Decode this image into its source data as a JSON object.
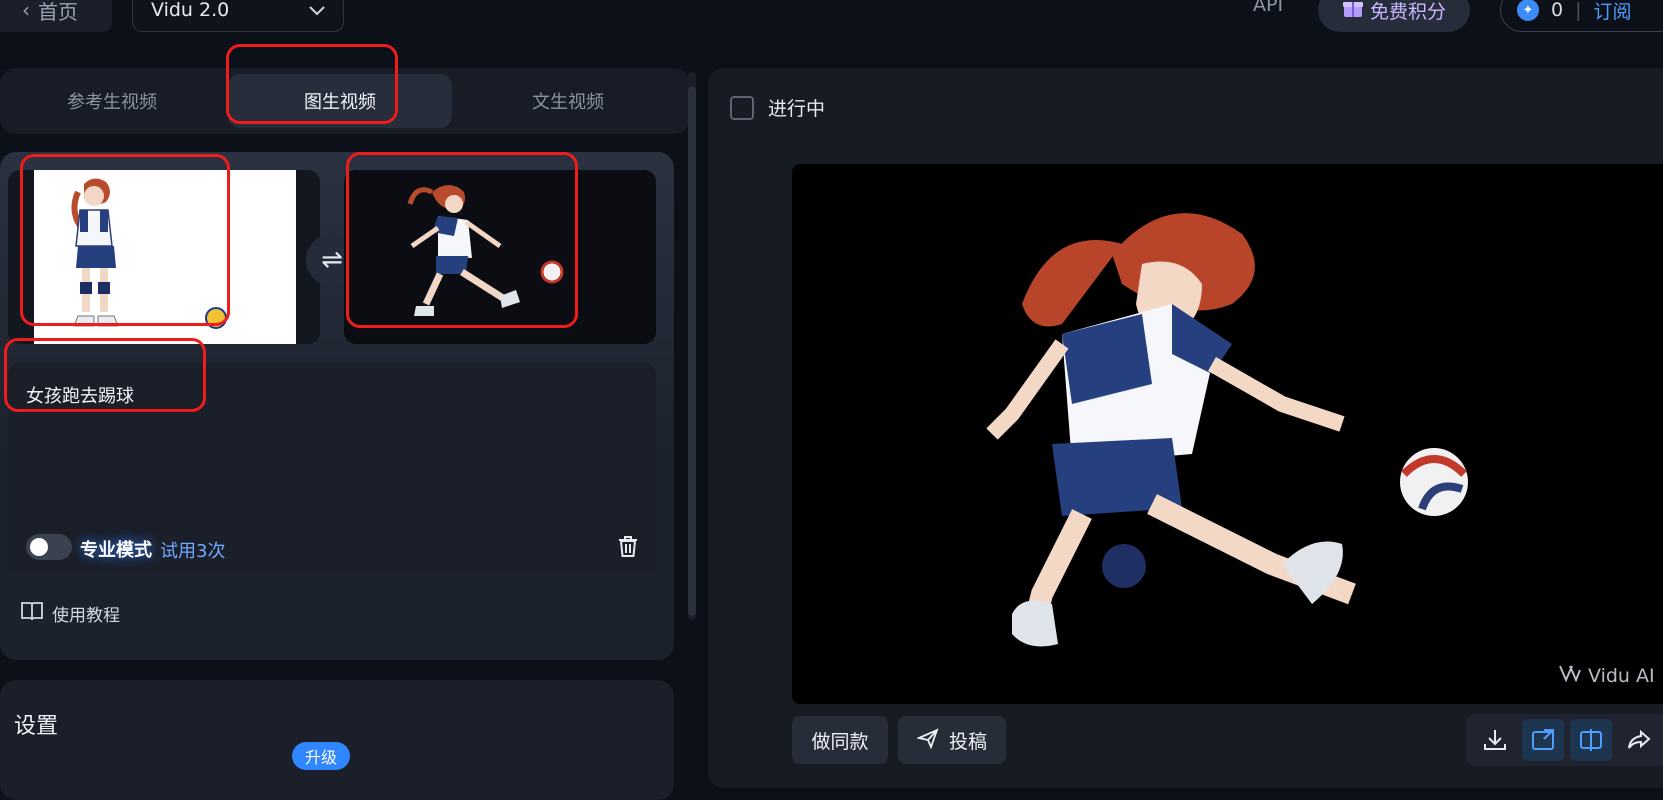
{
  "header": {
    "back_label": "首页",
    "model": "Vidu 2.0",
    "api_label": "API",
    "free_points_label": "免费积分",
    "credits_value": "0",
    "subscribe_label": "订阅"
  },
  "tabs": [
    {
      "label": "参考生视频",
      "active": false
    },
    {
      "label": "图生视频",
      "active": true
    },
    {
      "label": "文生视频",
      "active": false
    }
  ],
  "editor": {
    "prompt": "女孩跑去踢球",
    "pro_mode_label": "专业模式",
    "pro_mode_on": false,
    "trial_label": "试用3次",
    "tutorial_label": "使用教程"
  },
  "settings": {
    "title": "设置",
    "upgrade_label": "升级"
  },
  "results": {
    "filter_label": "进行中",
    "watermark": "Vidu AI",
    "same_style_label": "做同款",
    "submit_label": "投稿"
  },
  "icons": {
    "back": "chevron-left-icon",
    "dropdown": "chevron-down-icon",
    "gift": "gift-icon",
    "swap": "swap-icon",
    "trash": "trash-icon",
    "book": "book-icon",
    "send": "send-icon",
    "download": "download-icon",
    "expand": "expand-icon",
    "compare": "compare-icon",
    "share": "share-icon"
  },
  "colors": {
    "accent": "#2f86ff",
    "annotation": "#ef1c1c"
  }
}
